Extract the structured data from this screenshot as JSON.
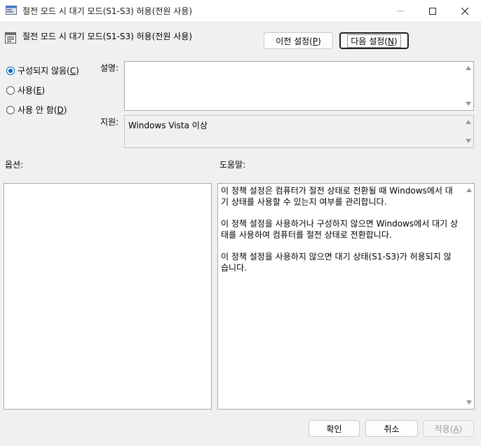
{
  "window": {
    "title": "절전 모드 시 대기 모드(S1-S3) 허용(전원 사용)",
    "icons": {
      "app": "policy-icon",
      "minimize": "minimize-icon",
      "maximize": "maximize-icon",
      "close": "close-icon"
    }
  },
  "header": {
    "title": "절전 모드 시 대기 모드(S1-S3) 허용(전원 사용)",
    "prev_label": "이전 설정(",
    "prev_key": "P",
    "prev_suffix": ")",
    "next_label": "다음 설정(",
    "next_key": "N",
    "next_suffix": ")"
  },
  "options": {
    "not_configured": {
      "label": "구성되지 않음(",
      "key": "C",
      "suffix": ")",
      "checked": true
    },
    "enabled": {
      "label": "사용(",
      "key": "E",
      "suffix": ")",
      "checked": false
    },
    "disabled": {
      "label": "사용 안 함(",
      "key": "D",
      "suffix": ")",
      "checked": false
    }
  },
  "labels": {
    "comment": "설명:",
    "supported": "지원:",
    "options": "옵션:",
    "help": "도움말:"
  },
  "supported_on": "Windows Vista 이상",
  "help": {
    "p1": "이 정책 설정은 컴퓨터가 절전 상태로 전환될 때 Windows에서 대기 상태를 사용할 수 있는지 여부를 관리합니다.",
    "p2": "이 정책 설정을 사용하거나 구성하지 않으면 Windows에서 대기 상태를 사용하여 컴퓨터를 절전 상태로 전환합니다.",
    "p3": "이 정책 설정을 사용하지 않으면 대기 상태(S1-S3)가 허용되지 않습니다."
  },
  "footer": {
    "ok": "확인",
    "cancel": "취소",
    "apply_label": "적용(",
    "apply_key": "A",
    "apply_suffix": ")"
  },
  "colors": {
    "accent": "#0067c0",
    "background": "#f0f0f0"
  }
}
